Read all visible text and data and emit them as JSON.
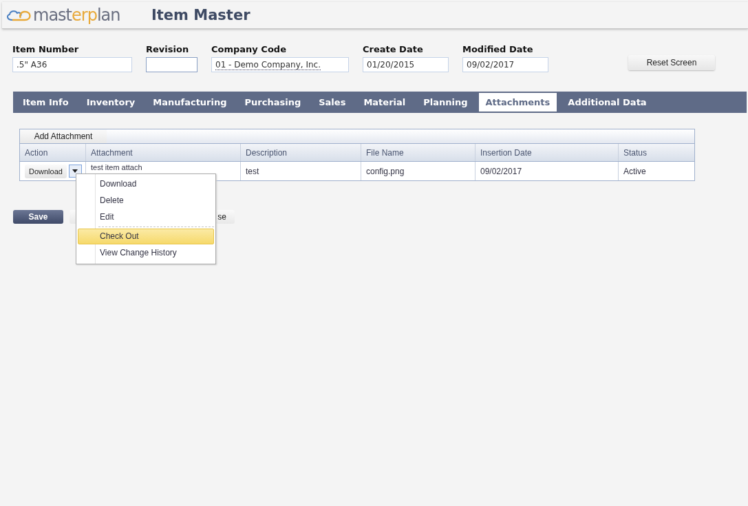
{
  "header": {
    "logo": {
      "part1": "mast",
      "part2": "erp",
      "part3": "lan"
    },
    "title": "Item Master"
  },
  "fields": [
    {
      "label": "Item Number",
      "value": ".5\" A36",
      "kind": "text"
    },
    {
      "label": "Revision",
      "kind": "text"
    },
    {
      "label": "Company Code",
      "value": "01 - Demo Company, Inc.",
      "kind": "select"
    },
    {
      "label": "Create Date",
      "value": "01/20/2015",
      "kind": "text"
    },
    {
      "label": "Modified Date",
      "value": "09/02/2017",
      "kind": "text"
    }
  ],
  "reset_button": "Reset Screen",
  "tabs": [
    {
      "label": "Item Info",
      "selected": false
    },
    {
      "label": "Inventory",
      "selected": false
    },
    {
      "label": "Manufacturing",
      "selected": false
    },
    {
      "label": "Purchasing",
      "selected": false
    },
    {
      "label": "Sales",
      "selected": false
    },
    {
      "label": "Material",
      "selected": false
    },
    {
      "label": "Planning",
      "selected": false
    },
    {
      "label": "Attachments",
      "selected": true
    },
    {
      "label": "Additional Data",
      "selected": false
    }
  ],
  "add_button": "Add Attachment",
  "table": {
    "columns": [
      "Action",
      "Attachment",
      "Description",
      "File Name",
      "Insertion Date",
      "Status"
    ],
    "rows": [
      {
        "action": "Download",
        "attachment": "test item attach",
        "description": "test",
        "file_name": "config.png",
        "insertion_date": "09/02/2017",
        "status": "Active"
      }
    ]
  },
  "menu": {
    "items": [
      {
        "label": "Download",
        "selected": false,
        "separator_after": false
      },
      {
        "label": "Delete",
        "selected": false,
        "separator_after": false
      },
      {
        "label": "Edit",
        "selected": false,
        "separator_after": true
      },
      {
        "label": "Check Out",
        "selected": true,
        "separator_after": false
      },
      {
        "label": "View Change History",
        "selected": false,
        "separator_after": false
      }
    ]
  },
  "footer_buttons": [
    {
      "label": "Save",
      "kind": "primary"
    },
    {
      "label": "se",
      "kind": "secondary"
    }
  ]
}
